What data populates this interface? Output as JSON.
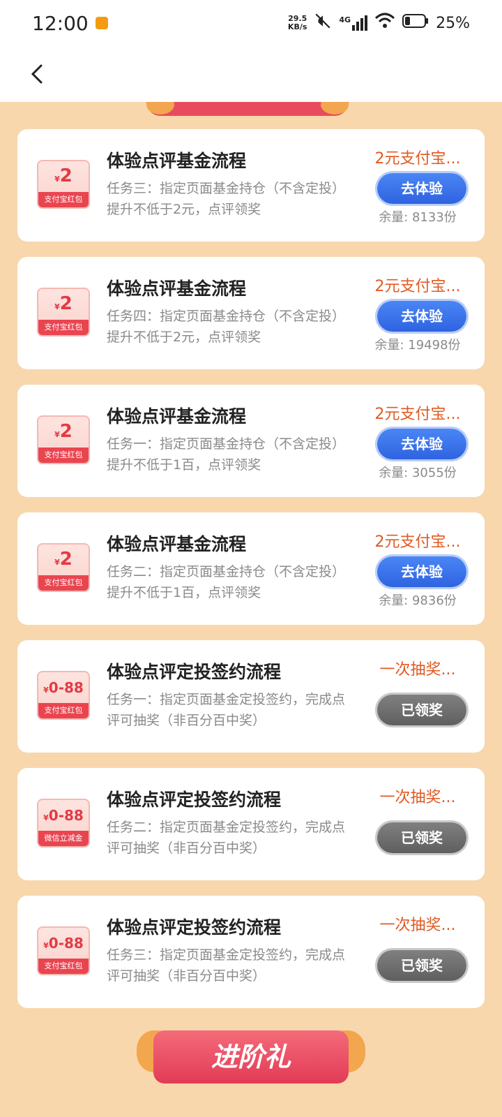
{
  "status_bar": {
    "time": "12:00",
    "speed_value": "29.5",
    "speed_unit": "KB/s",
    "network": "4G",
    "battery": "25%"
  },
  "cards": [
    {
      "title": "体验点评基金流程",
      "desc": "任务三：指定页面基金持仓（不含定投）提升不低于2元，点评领奖",
      "reward": "2元支付宝...",
      "button": "去体验",
      "button_style": "blue",
      "remain": "余量: 8133份",
      "coupon_amount": "2",
      "coupon_label": "支付宝红包"
    },
    {
      "title": "体验点评基金流程",
      "desc": "任务四：指定页面基金持仓（不含定投）提升不低于2元，点评领奖",
      "reward": "2元支付宝...",
      "button": "去体验",
      "button_style": "blue",
      "remain": "余量: 19498份",
      "coupon_amount": "2",
      "coupon_label": "支付宝红包"
    },
    {
      "title": "体验点评基金流程",
      "desc": "任务一：指定页面基金持仓（不含定投）提升不低于1百，点评领奖",
      "reward": "2元支付宝...",
      "button": "去体验",
      "button_style": "blue",
      "remain": "余量: 3055份",
      "coupon_amount": "2",
      "coupon_label": "支付宝红包"
    },
    {
      "title": "体验点评基金流程",
      "desc": "任务二：指定页面基金持仓（不含定投）提升不低于1百，点评领奖",
      "reward": "2元支付宝...",
      "button": "去体验",
      "button_style": "blue",
      "remain": "余量: 9836份",
      "coupon_amount": "2",
      "coupon_label": "支付宝红包"
    },
    {
      "title": "体验点评定投签约流程",
      "desc": "任务一：指定页面基金定投签约，完成点评可抽奖（非百分百中奖）",
      "reward": "一次抽奖...",
      "button": "已领奖",
      "button_style": "gray",
      "remain": "",
      "coupon_amount": "0-88",
      "coupon_label": "支付宝红包"
    },
    {
      "title": "体验点评定投签约流程",
      "desc": "任务二：指定页面基金定投签约，完成点评可抽奖（非百分百中奖）",
      "reward": "一次抽奖...",
      "button": "已领奖",
      "button_style": "gray",
      "remain": "",
      "coupon_amount": "0-88",
      "coupon_label": "微信立减金"
    },
    {
      "title": "体验点评定投签约流程",
      "desc": "任务三：指定页面基金定投签约，完成点评可抽奖（非百分百中奖）",
      "reward": "一次抽奖...",
      "button": "已领奖",
      "button_style": "gray",
      "remain": "",
      "coupon_amount": "0-88",
      "coupon_label": "支付宝红包"
    }
  ],
  "coupon_currency": "¥",
  "bottom_banner": "进阶礼",
  "colors": {
    "page_bg": "#f8d7ad",
    "accent_red": "#e94550",
    "reward_orange": "#e05a22",
    "button_blue": "#2f63e0",
    "button_gray": "#6b6b6b"
  }
}
